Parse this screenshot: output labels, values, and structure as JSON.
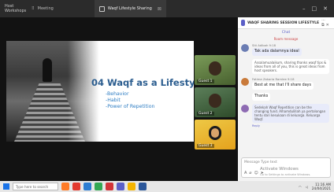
{
  "titlebar": {
    "app_name_line1": "Host",
    "app_name_line2": "Workshops",
    "tab_meeting": "Meeting",
    "tab_share": "Waqf Lifestyle Sharing",
    "window_controls": [
      "minimize-icon",
      "maximize-icon",
      "close-icon"
    ]
  },
  "slide": {
    "title": "04 Waqf as a Lifestyle",
    "bullets": [
      "-Behavior",
      "-Habit",
      "-Power of Repetition"
    ]
  },
  "participants": [
    {
      "name": "Guest 1"
    },
    {
      "name": "Guest 2"
    },
    {
      "name": "Guest 3"
    }
  ],
  "chat": {
    "title": "WAQF SHARING SESSION LIFESTYLE",
    "subtitle": "Chat",
    "system_message": "Room message",
    "messages": [
      {
        "meta": "Siti Adibah 9:18",
        "text": "Tak ada dalamnya ideal",
        "mine": true
      },
      {
        "meta": "",
        "text": "Assalamualaikum, sharing thanks waqf tips & ideas from all of you, this is great ideas from host speakers.",
        "small": true
      },
      {
        "meta": "Fatima Zakaria Ramlee 9:18",
        "text": "Best at me that I'll share days"
      },
      {
        "meta": "",
        "text": "Thanks"
      },
      {
        "meta": "",
        "text": "Sedekah Waqf Repetition can be the changing fund. Alhamdulillah ya pertolongan tentu dari kesukaan di keluarga. Keluarga Waqf.",
        "mine": true
      }
    ],
    "reply_label": "Reply",
    "compose_placeholder": "Message Type text",
    "watermark_title": "Activate Windows",
    "watermark_sub": "Go to Settings to activate Windows."
  },
  "taskbar": {
    "search_placeholder": "Type here to search",
    "app_icon_colors": [
      "#ff7b27",
      "#e23a2f",
      "#2d7dd2",
      "#34a853",
      "#d13438",
      "#5b5fc7",
      "#f4b400",
      "#2b579a"
    ],
    "time": "11:16 AM",
    "date": "24/04/2021"
  }
}
